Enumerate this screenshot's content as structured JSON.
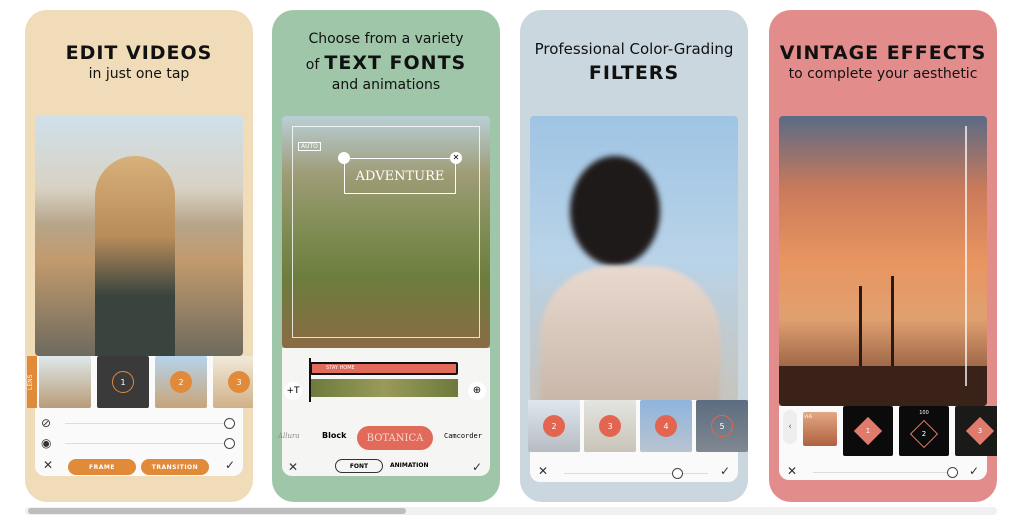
{
  "cards": [
    {
      "title": "EDIT VIDEOS",
      "subtitle": "in just one tap",
      "bg": "#f0dcb8",
      "lens_label": "LENS",
      "thumb_numbers": [
        "1",
        "2",
        "3"
      ],
      "buttons": [
        "FRAME",
        "TRANSITION"
      ]
    },
    {
      "pre": "Choose from a variety",
      "of": "of",
      "title": "TEXT FONTS",
      "subtitle": "and animations",
      "bg": "#9fc6a8",
      "overlay_text": "ADVENTURE",
      "auto_label": "AUTO",
      "clip_label": "STAY HOME",
      "fonts": [
        "Allura",
        "Block",
        "BOTANICA",
        "Camcorder"
      ],
      "tabs": [
        "FONT",
        "ANIMATION"
      ]
    },
    {
      "pre": "Professional Color-Grading",
      "title": "FILTERS",
      "bg": "#cad7df",
      "thumb_numbers": [
        "2",
        "3",
        "4",
        "5"
      ]
    },
    {
      "title": "VINTAGE EFFECTS",
      "subtitle": "to complete your aesthetic",
      "bg": "#e38c8c",
      "value_label": "100",
      "thumb_numbers": [
        "1",
        "2",
        "3"
      ],
      "thumb_tag": "VHS"
    }
  ],
  "scrollbar": {
    "position_percent": 0
  }
}
